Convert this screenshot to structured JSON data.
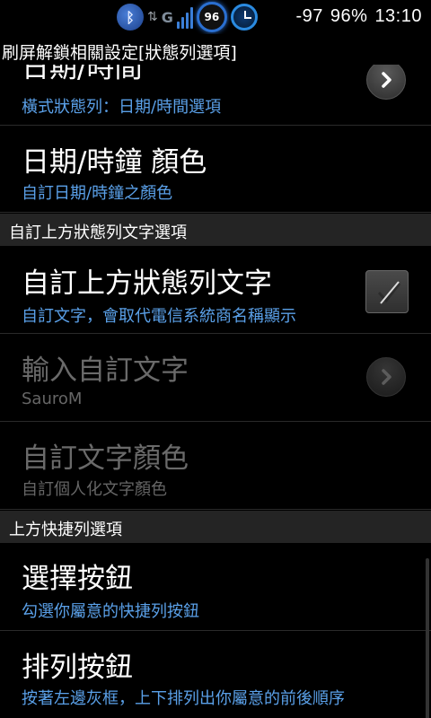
{
  "status_bar": {
    "network_type": "G",
    "badge_value": "96",
    "signal_dbm": "-97",
    "battery": "96%",
    "time": "13:10"
  },
  "title_bar": {
    "title": "刷屏解鎖相關設定[狀態列選項]"
  },
  "list": {
    "item_datetime": {
      "title": "日期/時間",
      "summary": "橫式狀態列：日期/時間選項"
    },
    "item_clock_color": {
      "title": "日期/時鐘 顏色",
      "summary": "自訂日期/時鐘之顏色"
    },
    "header_top_text": "自訂上方狀態列文字選項",
    "item_custom_text": {
      "title": "自訂上方狀態列文字",
      "summary": "自訂文字，會取代電信系統商名稱顯示",
      "checked": true
    },
    "item_input_text": {
      "title": "輸入自訂文字",
      "summary": "SauroM"
    },
    "item_text_color": {
      "title": "自訂文字顏色",
      "summary": "自訂個人化文字顏色"
    },
    "header_shortcut": "上方快捷列選項",
    "item_select_buttons": {
      "title": "選擇按鈕",
      "summary": "勾選你屬意的快捷列按鈕"
    },
    "item_arrange_buttons": {
      "title": "排列按鈕",
      "summary": "按著左邊灰框，上下排列出你屬意的前後順序"
    }
  },
  "colors": {
    "accent_summary": "#5aa0e8",
    "header_bg": "#242424",
    "disabled_text": "#6a6a6a"
  },
  "icons": {
    "bluetooth": "bluetooth-icon",
    "data": "data-arrows-icon",
    "signal": "signal-icon",
    "badge": "ring-badge-icon",
    "alarm": "alarm-clock-icon",
    "chevron": "chevron-right-icon",
    "checkbox": "checkbox-icon"
  }
}
